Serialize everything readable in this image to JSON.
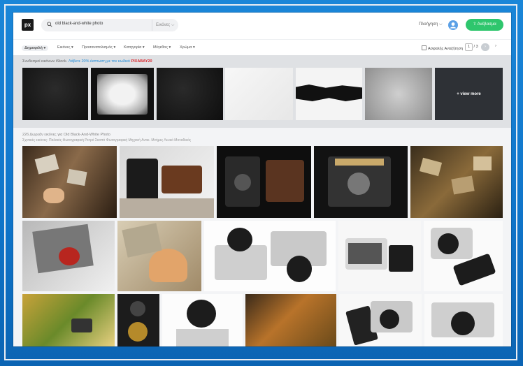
{
  "header": {
    "logo": "px",
    "search_value": "old black-and-white photo",
    "search_type": "Εικόνες ⌵",
    "login": "Πλοήγηση ⌵",
    "upload": "⇧ Ανέβασμα"
  },
  "filters": {
    "items": [
      "Δημοφιλή ▾",
      "Εικόνες ▾",
      "Προσανατολισμός ▾",
      "Κατηγορία ▾",
      "Μέγεθος ▾",
      "Χρώμα ▾"
    ],
    "safe_search": "Ασφαλής Αναζήτηση",
    "page_current": "1",
    "page_total": "/ 3",
    "next": "›",
    "arrow": "›"
  },
  "sponsored": {
    "prefix": "Συνδεσμοί εικόνων iStock.",
    "promo": "Λάβετε 20% έκπτωση με τον κωδικό",
    "code": "PIXABAY20",
    "view_more": "+ view more"
  },
  "results": {
    "count_line": "226 Δωρεάν εικόνες για Old Black-And-White Photo",
    "related": "Σχετικές εικόνες:  Παλαιός  Φωτογραφική  Ρετρό  Σκοπό  Φωτογραφική Μηχανή  Αντικ. Μνήμες  Λευκό  Μοναδικός"
  }
}
